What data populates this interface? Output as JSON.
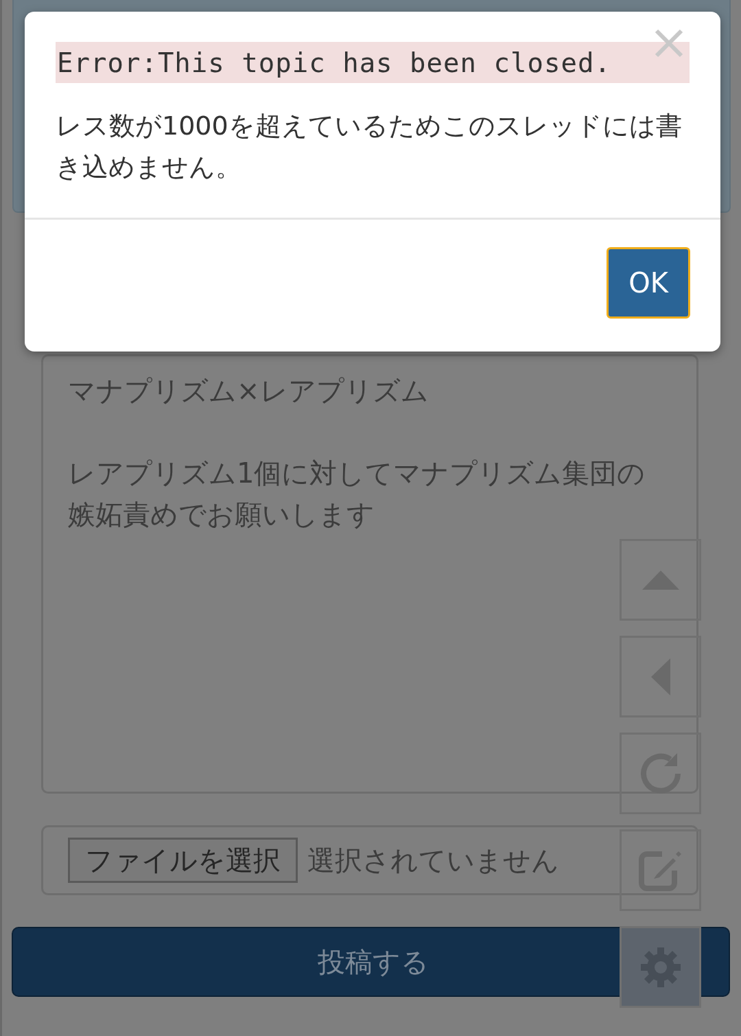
{
  "dialog": {
    "error": "Error:This topic has been closed.",
    "message": "レス数が1000を超えているためこのスレッドには書き込めません。",
    "button": "OK"
  },
  "form": {
    "message": [
      "マナプリズム×レアプリズム",
      "レアプリズム1個に対してマナプリズム集団の嫉妬責めでお願いします"
    ],
    "file_button": "ファイルを選択",
    "file_status": "選択されていません",
    "submit": "投稿する"
  },
  "side_buttons": [
    {
      "kind": "up"
    },
    {
      "kind": "left"
    },
    {
      "kind": "reload"
    },
    {
      "kind": "edit"
    },
    {
      "kind": "settings"
    }
  ]
}
